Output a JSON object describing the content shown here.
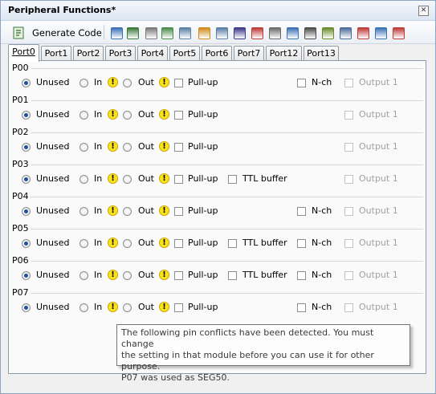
{
  "window": {
    "title": "Peripheral Functions*",
    "close_icon": "close-icon"
  },
  "toolbar": {
    "generate_label": "Generate Code",
    "icons": [
      "clock-tree-icon",
      "gear-icon",
      "timer-icon",
      "watchdog-icon",
      "grid-icon",
      "clock-icon",
      "sound-icon",
      "link-icon",
      "signal-icon",
      "waveform-icon",
      "pin-icon",
      "chip-icon",
      "lcd-icon",
      "network-icon",
      "plug-icon",
      "module-icon",
      "battery-icon"
    ]
  },
  "tabs": [
    "Port0",
    "Port1",
    "Port2",
    "Port3",
    "Port4",
    "Port5",
    "Port6",
    "Port7",
    "Port12",
    "Port13"
  ],
  "labels": {
    "unused": "Unused",
    "in": "In",
    "out": "Out",
    "pullup": "Pull-up",
    "ttl": "TTL buffer",
    "nch": "N-ch",
    "output1": "Output 1",
    "warn": "!"
  },
  "groups": [
    {
      "name": "P00",
      "ttl": false,
      "nch": true
    },
    {
      "name": "P01",
      "ttl": false,
      "nch": false
    },
    {
      "name": "P02",
      "ttl": false,
      "nch": false
    },
    {
      "name": "P03",
      "ttl": true,
      "nch": false
    },
    {
      "name": "P04",
      "ttl": false,
      "nch": true
    },
    {
      "name": "P05",
      "ttl": true,
      "nch": true
    },
    {
      "name": "P06",
      "ttl": true,
      "nch": true
    },
    {
      "name": "P07",
      "ttl": false,
      "nch": true
    }
  ],
  "tooltip": {
    "line1": "The following pin conflicts have been detected. You must change",
    "line2": "the setting in that module before you can use it for other purpose.",
    "line3": "P07 was used as SEG50."
  }
}
